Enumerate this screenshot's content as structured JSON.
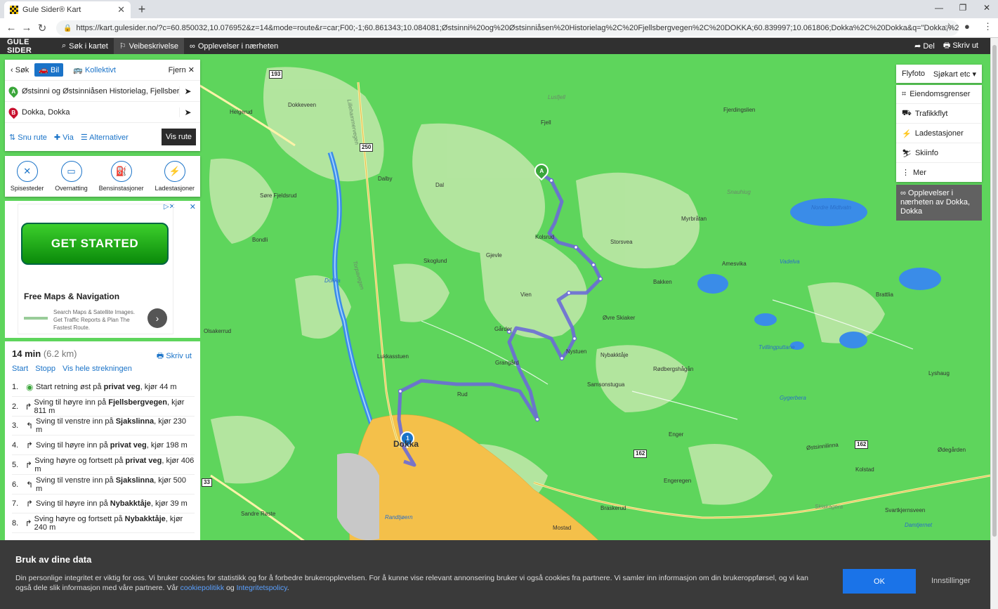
{
  "browser": {
    "tab_title": "Gule Sider® Kart",
    "url": "https://kart.gulesider.no/?c=60.850032,10.076952&z=14&mode=route&r=car;F00;-1;60.861343;10.084081;Østsinni%20og%20Østsinniåsen%20Historielag%2C%20Fjellsbergvegen%2C%20DOKKA;60.839997;10.061806;Dokka%2C%20Dokka&q=\"Dokka,%20DOKKA\";214..."
  },
  "appbar": {
    "logo": "GULE SIDER",
    "nav": [
      "Søk i kartet",
      "Veibeskrivelse",
      "Opplevelser i nærheten"
    ],
    "del": "Del",
    "skriv_ut": "Skriv ut"
  },
  "route": {
    "back": "Søk",
    "mode_car": "Bil",
    "mode_transit": "Kollektivt",
    "remove": "Fjern",
    "from": "Østsinni og Østsinniåsen Historielag, Fjellsbergvegen",
    "to": "Dokka, Dokka",
    "snu": "Snu rute",
    "via": "Via",
    "alt": "Alternativer",
    "vis": "Vis rute"
  },
  "pois": [
    "Spisesteder",
    "Overnatting",
    "Bensinstasjoner",
    "Ladestasjoner"
  ],
  "ad": {
    "cta": "GET STARTED",
    "title": "Free Maps & Navigation",
    "text": "Search Maps & Satellite Images. Get Traffic Reports & Plan The Fastest Route."
  },
  "summary": {
    "time": "14 min",
    "dist": "(6.2 km)",
    "print": "Skriv ut",
    "links": [
      "Start",
      "Stopp",
      "Vis hele strekningen"
    ]
  },
  "steps": [
    {
      "n": "1.",
      "pre": "Start retning øst på ",
      "b": "privat veg",
      "post": ", kjør 44 m"
    },
    {
      "n": "2.",
      "pre": "Sving til høyre inn på ",
      "b": "Fjellsbergvegen",
      "post": ", kjør 811 m"
    },
    {
      "n": "3.",
      "pre": "Sving til venstre inn på ",
      "b": "Sjakslinna",
      "post": ", kjør 230 m"
    },
    {
      "n": "4.",
      "pre": "Sving til høyre inn på ",
      "b": "privat veg",
      "post": ", kjør 198 m"
    },
    {
      "n": "5.",
      "pre": "Sving høyre og fortsett på ",
      "b": "privat veg",
      "post": ", kjør 406 m"
    },
    {
      "n": "6.",
      "pre": "Sving til venstre inn på ",
      "b": "Sjakslinna",
      "post": ", kjør 500 m"
    },
    {
      "n": "7.",
      "pre": "Sving til høyre inn på ",
      "b": "Nybakktåje",
      "post": ", kjør 39 m"
    },
    {
      "n": "8.",
      "pre": "Sving høyre og fortsett på ",
      "b": "Nybakktåje",
      "post": ", kjør 240 m"
    }
  ],
  "maptypes": {
    "flyfoto": "Flyfoto",
    "sjokart": "Sjøkart etc"
  },
  "layers": [
    "Eiendomsgrenser",
    "Trafikkflyt",
    "Ladestasjoner",
    "Skiinfo",
    "Mer"
  ],
  "opplevelser": "Opplevelser i nærheten av Dokka, Dokka",
  "map": {
    "labels": [
      "Dokkeveen",
      "Helgerud",
      "Lusfjell",
      "Fjell",
      "Fjerdingslien",
      "Dal",
      "Dalby",
      "Søre Fjeldsrud",
      "Bondli",
      "Kolsrud",
      "Storsvea",
      "Myrbråtan",
      "Nordre Midtvatn",
      "Snauhiug",
      "Amesvika",
      "Skoglund",
      "Gjevle",
      "Bakken",
      "Vadelva",
      "Brattlia",
      "Vien",
      "Øvre Skiaker",
      "Gårder",
      "Nystuen",
      "Nybakktåje",
      "Rødbergshågån",
      "Lukkasstuen",
      "Grangård",
      "Samsonstugua",
      "Tvillingputtane",
      "Lyshaug",
      "Rud",
      "Ødegården",
      "Gygerbera",
      "Enger",
      "Kolstad",
      "Engeregen",
      "Svartkjernsveen",
      "Braskerud",
      "Mostad",
      "Sandre Røste",
      "Dokka",
      "Lillehammervegen",
      "Torpavegen",
      "Kolsrud",
      "Lyshaug",
      "Østsinnilinna",
      "Dokka",
      "Olsakerrud",
      "Randtjøern",
      "Skiakagera",
      "Damtjernet",
      "Nystuen"
    ],
    "roads": [
      "193",
      "250",
      "162",
      "33",
      "162"
    ],
    "marker_a": "A",
    "marker_b": "1"
  },
  "cookie": {
    "title": "Bruk av dine data",
    "text": "Din personlige integritet er viktig for oss. Vi bruker cookies for statistikk og for å forbedre brukeropplevelsen. For å kunne vise relevant annonsering bruker vi også cookies fra partnere. Vi samler inn informasjon om din brukeroppførsel, og vi kan også dele slik informasjon med våre partnere. Vår ",
    "link1": "cookiepolitikk",
    "og": " og ",
    "link2": "Integritetspolicy",
    "end": ".",
    "ok": "OK",
    "settings": "Innstillinger"
  },
  "colors": {
    "accent": "#1a73c8",
    "route": "#6b6bd6",
    "map_green": "#5ed55c",
    "forest_light": "#b7e6a2",
    "water": "#3a8ce8",
    "town": "#f4c04a"
  }
}
